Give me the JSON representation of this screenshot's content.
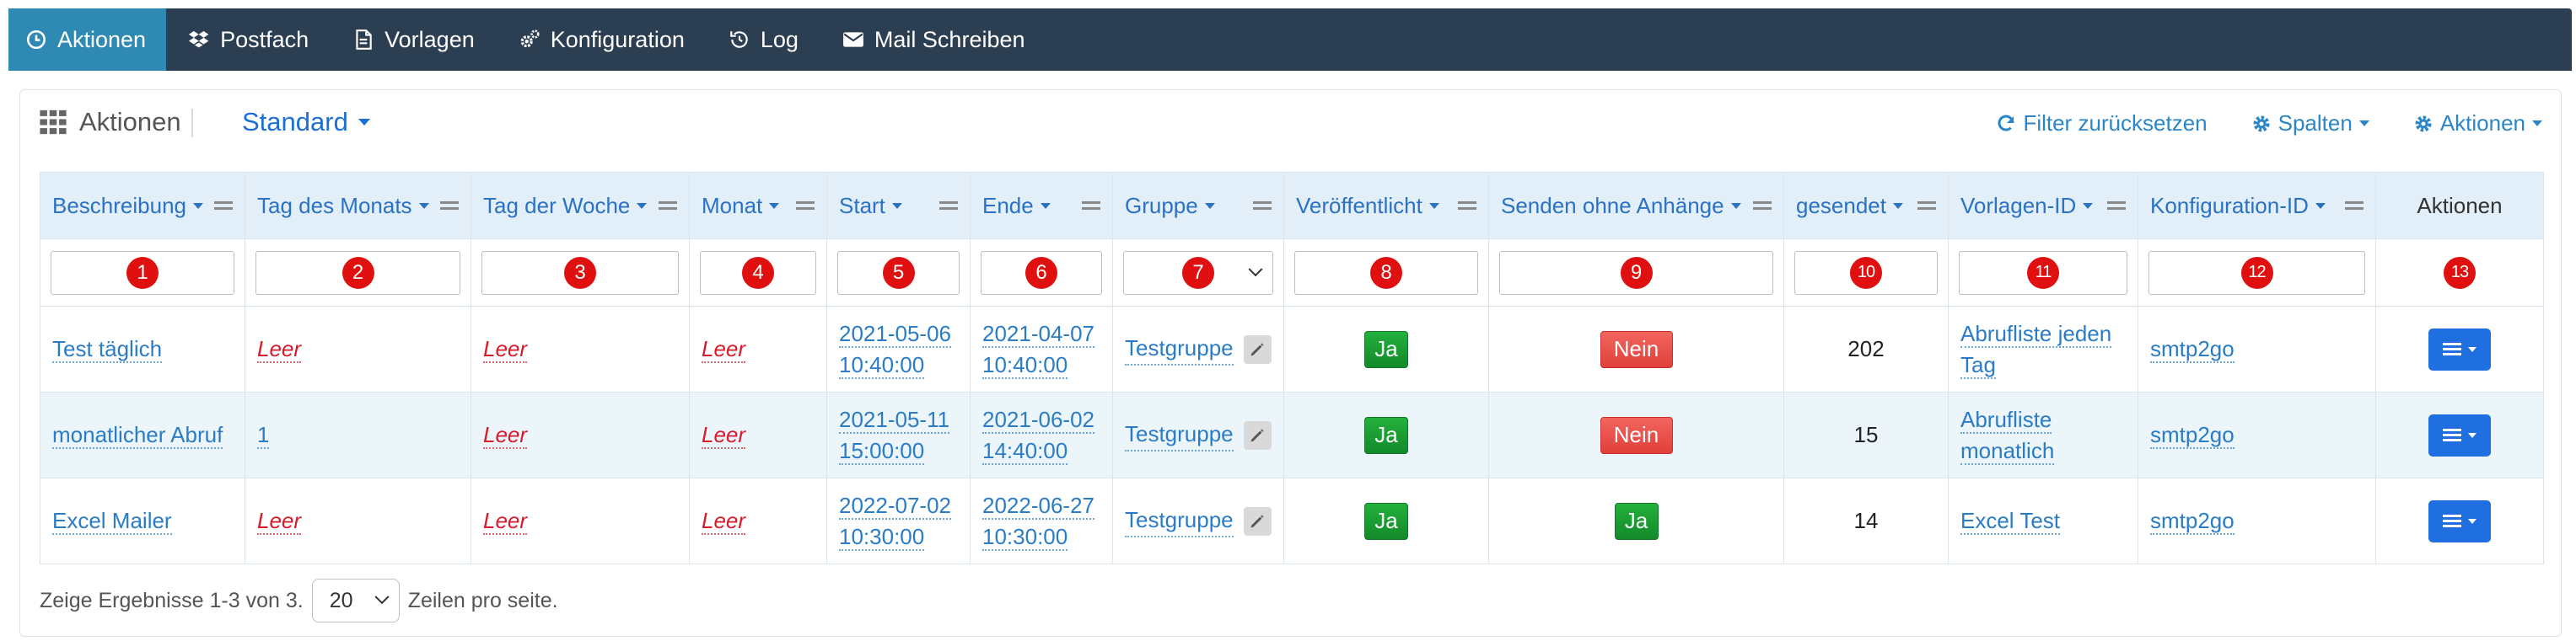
{
  "nav": {
    "items": [
      {
        "label": "Aktionen",
        "icon": "clock-icon",
        "active": true
      },
      {
        "label": "Postfach",
        "icon": "dropbox-icon"
      },
      {
        "label": "Vorlagen",
        "icon": "document-icon"
      },
      {
        "label": "Konfiguration",
        "icon": "gears-icon"
      },
      {
        "label": "Log",
        "icon": "history-icon"
      },
      {
        "label": "Mail Schreiben",
        "icon": "envelope-icon"
      }
    ]
  },
  "panel": {
    "title": "Aktionen",
    "view": "Standard",
    "reset_filter": "Filter zurücksetzen",
    "columns_menu": "Spalten",
    "actions_menu": "Aktionen"
  },
  "table": {
    "columns": [
      "Beschreibung",
      "Tag des Monats",
      "Tag der Woche",
      "Monat",
      "Start",
      "Ende",
      "Gruppe",
      "Veröffentlicht",
      "Senden ohne Anhänge",
      "gesendet",
      "Vorlagen-ID",
      "Konfiguration-ID",
      "Aktionen"
    ],
    "filter_markers": [
      "1",
      "2",
      "3",
      "4",
      "5",
      "6",
      "7",
      "8",
      "9",
      "10",
      "11",
      "12",
      "13"
    ],
    "empty_label": "Leer",
    "rows": [
      {
        "beschreibung": "Test täglich",
        "tag_monat": "Leer",
        "tag_woche": "Leer",
        "monat": "Leer",
        "start_date": "2021-05-06",
        "start_time": "10:40:00",
        "ende_date": "2021-04-07",
        "ende_time": "10:40:00",
        "gruppe": "Testgruppe",
        "veroeffentlicht": "Ja",
        "ohne_anhaenge": "Nein",
        "gesendet": "202",
        "vorlage_l1": "Abrufliste jeden",
        "vorlage_l2": "Tag",
        "konfiguration": "smtp2go"
      },
      {
        "beschreibung": "monatlicher Abruf",
        "tag_monat": "1",
        "tag_woche": "Leer",
        "monat": "Leer",
        "start_date": "2021-05-11",
        "start_time": "15:00:00",
        "ende_date": "2021-06-02",
        "ende_time": "14:40:00",
        "gruppe": "Testgruppe",
        "veroeffentlicht": "Ja",
        "ohne_anhaenge": "Nein",
        "gesendet": "15",
        "vorlage_l1": "Abrufliste",
        "vorlage_l2": "monatlich",
        "konfiguration": "smtp2go"
      },
      {
        "beschreibung": "Excel Mailer",
        "tag_monat": "Leer",
        "tag_woche": "Leer",
        "monat": "Leer",
        "start_date": "2022-07-02",
        "start_time": "10:30:00",
        "ende_date": "2022-06-27",
        "ende_time": "10:30:00",
        "gruppe": "Testgruppe",
        "veroeffentlicht": "Ja",
        "ohne_anhaenge": "Ja",
        "gesendet": "14",
        "vorlage_l1": "Excel Test",
        "vorlage_l2": "",
        "konfiguration": "smtp2go"
      }
    ]
  },
  "footer": {
    "prefix": "Zeige Ergebnisse 1-3 von 3.",
    "page_size": "20",
    "suffix": "Zeilen pro seite."
  },
  "colors": {
    "navbar": "#2c3e52",
    "nav_active": "#2f8ab3",
    "link": "#2b7cc7",
    "empty": "#d81b2b",
    "yes": "#1a9c35",
    "no": "#e8504a",
    "action_button": "#1f6fe0",
    "marker": "#e01010"
  }
}
